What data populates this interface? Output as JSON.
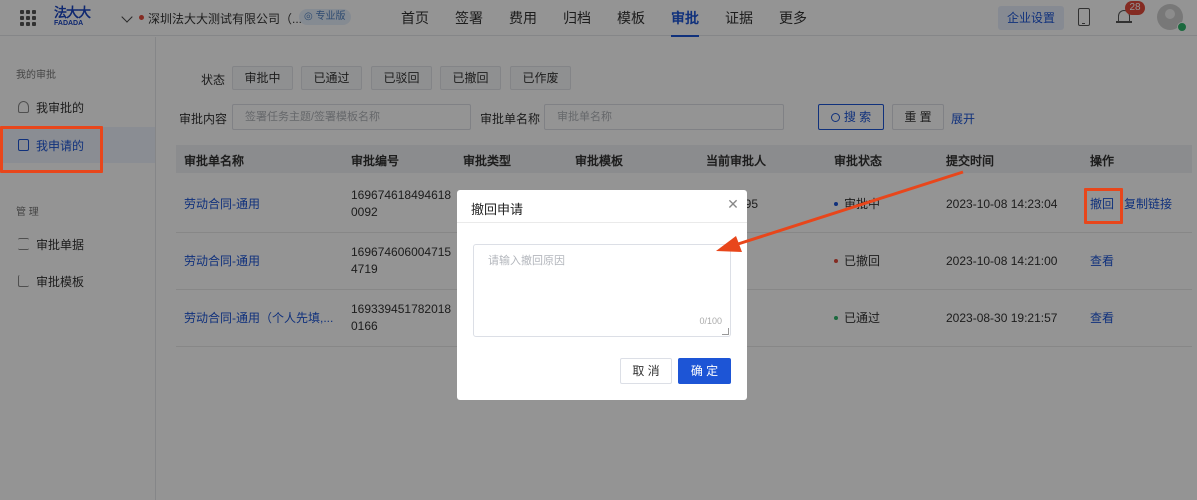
{
  "topbar": {
    "logo_line1": "法大大",
    "logo_line2": "FADADA",
    "company": "深圳法大大测试有限公司（...",
    "edition_badge": "专业版",
    "nav": [
      "首页",
      "签署",
      "费用",
      "归档",
      "模板",
      "审批",
      "证据",
      "更多"
    ],
    "active_nav": "审批",
    "enterprise_settings": "企业设置",
    "notification_count": "28"
  },
  "sidebar": {
    "section1": "我的审批",
    "items1": [
      "我审批的",
      "我申请的"
    ],
    "active_item": "我申请的",
    "section2": "管 理",
    "items2": [
      "审批单据",
      "审批模板"
    ]
  },
  "filters": {
    "status_label": "状态",
    "status_options": [
      "审批中",
      "已通过",
      "已驳回",
      "已撤回",
      "已作废"
    ],
    "content_label": "审批内容",
    "content_placeholder": "签署任务主题/签署模板名称",
    "name_label": "审批单名称",
    "name_placeholder": "审批单名称",
    "search": "搜 索",
    "reset": "重 置",
    "expand": "展开"
  },
  "table": {
    "columns": [
      "审批单名称",
      "审批编号",
      "审批类型",
      "审批模板",
      "当前审批人",
      "审批状态",
      "提交时间",
      "操作"
    ],
    "rows": [
      {
        "name": "劳动合同-通用",
        "id_line1": "169674618494618",
        "id_line2": "0092",
        "approver_fragment": "595",
        "status": "审批中",
        "status_color": "#1d55d6",
        "time": "2023-10-08 14:23:04",
        "actions": [
          "撤回",
          "复制链接"
        ]
      },
      {
        "name": "劳动合同-通用",
        "id_line1": "169674606004715",
        "id_line2": "4719",
        "approver_fragment": "",
        "status": "已撤回",
        "status_color": "#e34b3b",
        "time": "2023-10-08 14:21:00",
        "actions": [
          "查看"
        ]
      },
      {
        "name": "劳动合同-通用（个人先填,...",
        "id_line1": "169339451782018",
        "id_line2": "0166",
        "approver_fragment": "",
        "status": "已通过",
        "status_color": "#2fb56b",
        "time": "2023-08-30 19:21:57",
        "actions": [
          "查看"
        ]
      }
    ]
  },
  "modal": {
    "title": "撤回申请",
    "placeholder": "请输入撤回原因",
    "counter": "0/100",
    "cancel": "取 消",
    "confirm": "确 定"
  },
  "colors": {
    "accent": "#1d55d6",
    "annotation": "#e8461b"
  }
}
